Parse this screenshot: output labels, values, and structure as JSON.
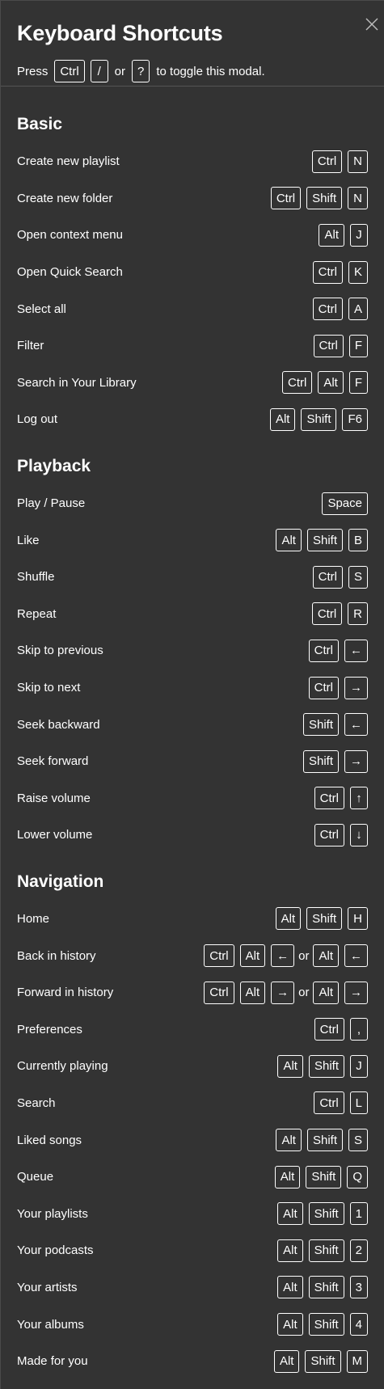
{
  "modal": {
    "title": "Keyboard Shortcuts",
    "toggle": {
      "press": "Press",
      "key1": "Ctrl",
      "key2": "/",
      "or": "or",
      "key3": "?",
      "suffix": "to toggle this modal."
    }
  },
  "sections": [
    {
      "id": "basic",
      "title": "Basic",
      "rows": [
        {
          "label": "Create new playlist",
          "keys": [
            "Ctrl",
            "N"
          ]
        },
        {
          "label": "Create new folder",
          "keys": [
            "Ctrl",
            "Shift",
            "N"
          ]
        },
        {
          "label": "Open context menu",
          "keys": [
            "Alt",
            "J"
          ]
        },
        {
          "label": "Open Quick Search",
          "keys": [
            "Ctrl",
            "K"
          ]
        },
        {
          "label": "Select all",
          "keys": [
            "Ctrl",
            "A"
          ]
        },
        {
          "label": "Filter",
          "keys": [
            "Ctrl",
            "F"
          ]
        },
        {
          "label": "Search in Your Library",
          "keys": [
            "Ctrl",
            "Alt",
            "F"
          ]
        },
        {
          "label": "Log out",
          "keys": [
            "Alt",
            "Shift",
            "F6"
          ]
        }
      ]
    },
    {
      "id": "playback",
      "title": "Playback",
      "rows": [
        {
          "label": "Play / Pause",
          "keys": [
            "Space"
          ]
        },
        {
          "label": "Like",
          "keys": [
            "Alt",
            "Shift",
            "B"
          ]
        },
        {
          "label": "Shuffle",
          "keys": [
            "Ctrl",
            "S"
          ]
        },
        {
          "label": "Repeat",
          "keys": [
            "Ctrl",
            "R"
          ]
        },
        {
          "label": "Skip to previous",
          "keys": [
            "Ctrl",
            "←"
          ]
        },
        {
          "label": "Skip to next",
          "keys": [
            "Ctrl",
            "→"
          ]
        },
        {
          "label": "Seek backward",
          "keys": [
            "Shift",
            "←"
          ]
        },
        {
          "label": "Seek forward",
          "keys": [
            "Shift",
            "→"
          ]
        },
        {
          "label": "Raise volume",
          "keys": [
            "Ctrl",
            "↑"
          ]
        },
        {
          "label": "Lower volume",
          "keys": [
            "Ctrl",
            "↓"
          ]
        }
      ]
    },
    {
      "id": "navigation",
      "title": "Navigation",
      "rows": [
        {
          "label": "Home",
          "keys": [
            "Alt",
            "Shift",
            "H"
          ]
        },
        {
          "label": "Back in history",
          "keys": [
            "Ctrl",
            "Alt",
            "←"
          ],
          "alt_keys": [
            "Alt",
            "←"
          ]
        },
        {
          "label": "Forward in history",
          "keys": [
            "Ctrl",
            "Alt",
            "→"
          ],
          "alt_keys": [
            "Alt",
            "→"
          ]
        },
        {
          "label": "Preferences",
          "keys": [
            "Ctrl",
            ","
          ]
        },
        {
          "label": "Currently playing",
          "keys": [
            "Alt",
            "Shift",
            "J"
          ]
        },
        {
          "label": "Search",
          "keys": [
            "Ctrl",
            "L"
          ]
        },
        {
          "label": "Liked songs",
          "keys": [
            "Alt",
            "Shift",
            "S"
          ]
        },
        {
          "label": "Queue",
          "keys": [
            "Alt",
            "Shift",
            "Q"
          ]
        },
        {
          "label": "Your playlists",
          "keys": [
            "Alt",
            "Shift",
            "1"
          ]
        },
        {
          "label": "Your podcasts",
          "keys": [
            "Alt",
            "Shift",
            "2"
          ]
        },
        {
          "label": "Your artists",
          "keys": [
            "Alt",
            "Shift",
            "3"
          ]
        },
        {
          "label": "Your albums",
          "keys": [
            "Alt",
            "Shift",
            "4"
          ]
        },
        {
          "label": "Made for you",
          "keys": [
            "Alt",
            "Shift",
            "M"
          ]
        }
      ]
    }
  ],
  "alt_separator": "or",
  "icons": {
    "close": "close-icon"
  },
  "colors": {
    "background": "#333333",
    "text": "#ffffff",
    "divider": "#555555"
  }
}
